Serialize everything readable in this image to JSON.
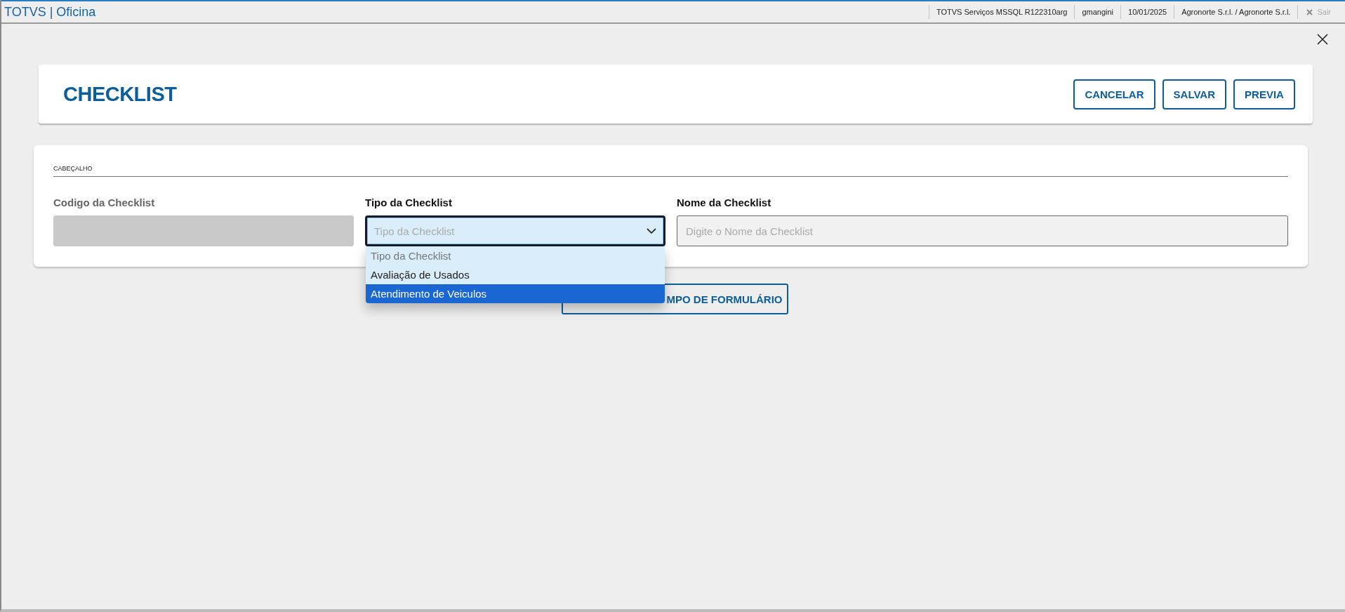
{
  "app": {
    "title": "TOTVS | Oficina"
  },
  "status_bar": {
    "items": [
      "TOTVS Serviços MSSQL R122310arg",
      "gmangini",
      "10/01/2025",
      "Agronorte S.r.l. / Agronorte S.r.l."
    ],
    "logout": {
      "label": "Sair",
      "disabled": true
    }
  },
  "page": {
    "title": "CHECKLIST",
    "actions": [
      "CANCELAR",
      "SALVAR",
      "PREVIA"
    ]
  },
  "section": {
    "title": "CABEÇALHO",
    "fields": [
      {
        "kind": "text",
        "label": "Codigo da Checklist",
        "disabled": true
      },
      {
        "kind": "select",
        "label": "Tipo da Checklist",
        "placeholder": "Tipo da Checklist",
        "expanded": true,
        "options": [
          {
            "label": "Tipo da Checklist",
            "disabled": true,
            "selected": false
          },
          {
            "label": "Avaliação de Usados",
            "disabled": false,
            "selected": false
          },
          {
            "label": "Atendimento de Veiculos",
            "disabled": false,
            "selected": true
          }
        ]
      },
      {
        "kind": "text",
        "label": "Nome da Checklist",
        "placeholder": "Digite o Nome da Checklist",
        "disabled": false
      }
    ]
  },
  "add_button": {
    "label": "MPO DE FORMULÁRIO"
  }
}
